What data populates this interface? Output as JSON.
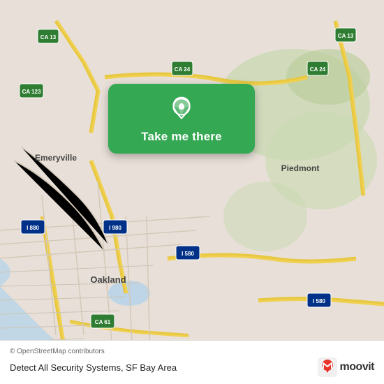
{
  "map": {
    "attribution": "© OpenStreetMap contributors",
    "location_label": "Detect All Security Systems, SF Bay Area",
    "moovit_text": "moovit",
    "bg_color": "#e8e0d8"
  },
  "button": {
    "label": "Take me there",
    "pin_icon": "location-pin-icon"
  }
}
